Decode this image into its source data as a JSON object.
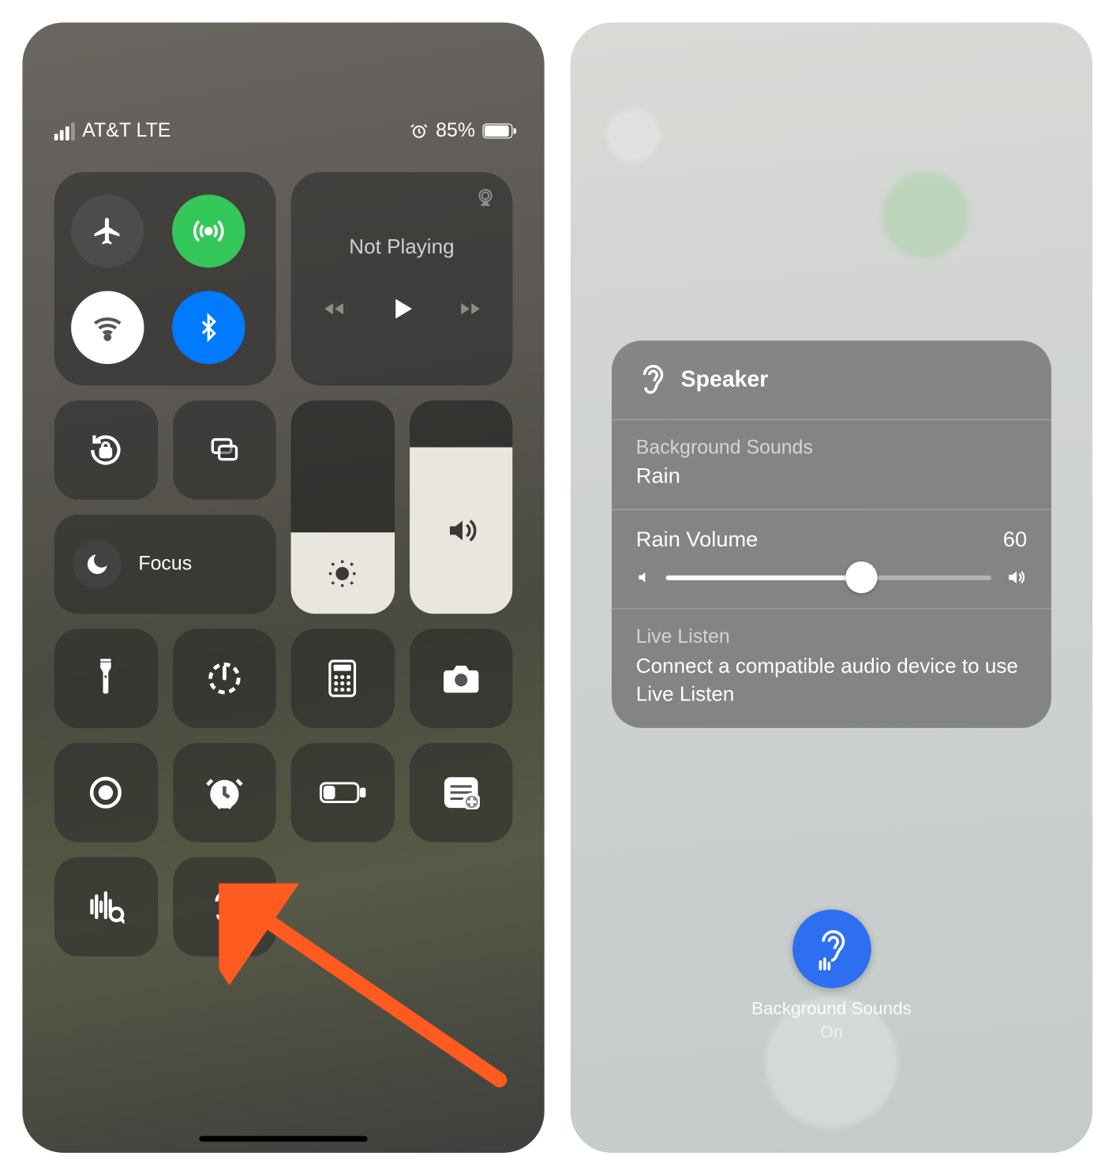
{
  "left": {
    "status": {
      "carrier": "AT&T LTE",
      "battery_pct": "85%"
    },
    "media": {
      "title": "Not Playing"
    },
    "focus": {
      "label": "Focus"
    },
    "brightness_pct": 38,
    "volume_pct": 78
  },
  "right": {
    "card": {
      "header": "Speaker",
      "bg_sounds_label": "Background Sounds",
      "bg_sounds_value": "Rain",
      "volume_label": "Rain Volume",
      "volume_value": "60",
      "live_listen_label": "Live Listen",
      "live_listen_body": "Connect a compatible audio device to use Live Listen"
    },
    "button": {
      "title": "Background Sounds",
      "state": "On"
    }
  },
  "colors": {
    "green": "#34c759",
    "blue": "#007aff",
    "orange": "#ff5a1f",
    "accent_blue": "#2e6ff2"
  }
}
